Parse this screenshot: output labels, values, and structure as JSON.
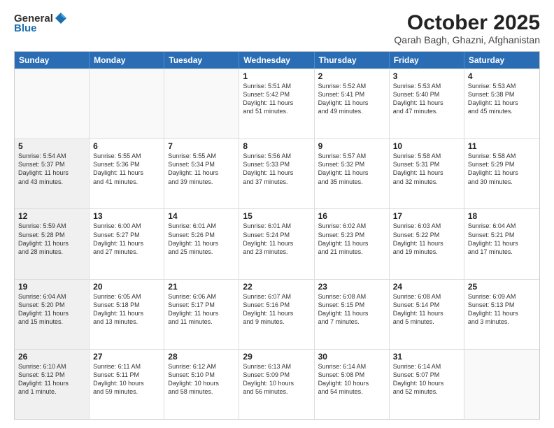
{
  "header": {
    "logo_general": "General",
    "logo_blue": "Blue",
    "month": "October 2025",
    "location": "Qarah Bagh, Ghazni, Afghanistan"
  },
  "weekdays": [
    "Sunday",
    "Monday",
    "Tuesday",
    "Wednesday",
    "Thursday",
    "Friday",
    "Saturday"
  ],
  "weeks": [
    [
      {
        "day": "",
        "text": "",
        "shaded": true
      },
      {
        "day": "",
        "text": "",
        "shaded": true
      },
      {
        "day": "",
        "text": "",
        "shaded": true
      },
      {
        "day": "1",
        "text": "Sunrise: 5:51 AM\nSunset: 5:42 PM\nDaylight: 11 hours\nand 51 minutes.",
        "shaded": false
      },
      {
        "day": "2",
        "text": "Sunrise: 5:52 AM\nSunset: 5:41 PM\nDaylight: 11 hours\nand 49 minutes.",
        "shaded": false
      },
      {
        "day": "3",
        "text": "Sunrise: 5:53 AM\nSunset: 5:40 PM\nDaylight: 11 hours\nand 47 minutes.",
        "shaded": false
      },
      {
        "day": "4",
        "text": "Sunrise: 5:53 AM\nSunset: 5:38 PM\nDaylight: 11 hours\nand 45 minutes.",
        "shaded": false
      }
    ],
    [
      {
        "day": "5",
        "text": "Sunrise: 5:54 AM\nSunset: 5:37 PM\nDaylight: 11 hours\nand 43 minutes.",
        "shaded": true
      },
      {
        "day": "6",
        "text": "Sunrise: 5:55 AM\nSunset: 5:36 PM\nDaylight: 11 hours\nand 41 minutes.",
        "shaded": false
      },
      {
        "day": "7",
        "text": "Sunrise: 5:55 AM\nSunset: 5:34 PM\nDaylight: 11 hours\nand 39 minutes.",
        "shaded": false
      },
      {
        "day": "8",
        "text": "Sunrise: 5:56 AM\nSunset: 5:33 PM\nDaylight: 11 hours\nand 37 minutes.",
        "shaded": false
      },
      {
        "day": "9",
        "text": "Sunrise: 5:57 AM\nSunset: 5:32 PM\nDaylight: 11 hours\nand 35 minutes.",
        "shaded": false
      },
      {
        "day": "10",
        "text": "Sunrise: 5:58 AM\nSunset: 5:31 PM\nDaylight: 11 hours\nand 32 minutes.",
        "shaded": false
      },
      {
        "day": "11",
        "text": "Sunrise: 5:58 AM\nSunset: 5:29 PM\nDaylight: 11 hours\nand 30 minutes.",
        "shaded": false
      }
    ],
    [
      {
        "day": "12",
        "text": "Sunrise: 5:59 AM\nSunset: 5:28 PM\nDaylight: 11 hours\nand 28 minutes.",
        "shaded": true
      },
      {
        "day": "13",
        "text": "Sunrise: 6:00 AM\nSunset: 5:27 PM\nDaylight: 11 hours\nand 27 minutes.",
        "shaded": false
      },
      {
        "day": "14",
        "text": "Sunrise: 6:01 AM\nSunset: 5:26 PM\nDaylight: 11 hours\nand 25 minutes.",
        "shaded": false
      },
      {
        "day": "15",
        "text": "Sunrise: 6:01 AM\nSunset: 5:24 PM\nDaylight: 11 hours\nand 23 minutes.",
        "shaded": false
      },
      {
        "day": "16",
        "text": "Sunrise: 6:02 AM\nSunset: 5:23 PM\nDaylight: 11 hours\nand 21 minutes.",
        "shaded": false
      },
      {
        "day": "17",
        "text": "Sunrise: 6:03 AM\nSunset: 5:22 PM\nDaylight: 11 hours\nand 19 minutes.",
        "shaded": false
      },
      {
        "day": "18",
        "text": "Sunrise: 6:04 AM\nSunset: 5:21 PM\nDaylight: 11 hours\nand 17 minutes.",
        "shaded": false
      }
    ],
    [
      {
        "day": "19",
        "text": "Sunrise: 6:04 AM\nSunset: 5:20 PM\nDaylight: 11 hours\nand 15 minutes.",
        "shaded": true
      },
      {
        "day": "20",
        "text": "Sunrise: 6:05 AM\nSunset: 5:18 PM\nDaylight: 11 hours\nand 13 minutes.",
        "shaded": false
      },
      {
        "day": "21",
        "text": "Sunrise: 6:06 AM\nSunset: 5:17 PM\nDaylight: 11 hours\nand 11 minutes.",
        "shaded": false
      },
      {
        "day": "22",
        "text": "Sunrise: 6:07 AM\nSunset: 5:16 PM\nDaylight: 11 hours\nand 9 minutes.",
        "shaded": false
      },
      {
        "day": "23",
        "text": "Sunrise: 6:08 AM\nSunset: 5:15 PM\nDaylight: 11 hours\nand 7 minutes.",
        "shaded": false
      },
      {
        "day": "24",
        "text": "Sunrise: 6:08 AM\nSunset: 5:14 PM\nDaylight: 11 hours\nand 5 minutes.",
        "shaded": false
      },
      {
        "day": "25",
        "text": "Sunrise: 6:09 AM\nSunset: 5:13 PM\nDaylight: 11 hours\nand 3 minutes.",
        "shaded": false
      }
    ],
    [
      {
        "day": "26",
        "text": "Sunrise: 6:10 AM\nSunset: 5:12 PM\nDaylight: 11 hours\nand 1 minute.",
        "shaded": true
      },
      {
        "day": "27",
        "text": "Sunrise: 6:11 AM\nSunset: 5:11 PM\nDaylight: 10 hours\nand 59 minutes.",
        "shaded": false
      },
      {
        "day": "28",
        "text": "Sunrise: 6:12 AM\nSunset: 5:10 PM\nDaylight: 10 hours\nand 58 minutes.",
        "shaded": false
      },
      {
        "day": "29",
        "text": "Sunrise: 6:13 AM\nSunset: 5:09 PM\nDaylight: 10 hours\nand 56 minutes.",
        "shaded": false
      },
      {
        "day": "30",
        "text": "Sunrise: 6:14 AM\nSunset: 5:08 PM\nDaylight: 10 hours\nand 54 minutes.",
        "shaded": false
      },
      {
        "day": "31",
        "text": "Sunrise: 6:14 AM\nSunset: 5:07 PM\nDaylight: 10 hours\nand 52 minutes.",
        "shaded": false
      },
      {
        "day": "",
        "text": "",
        "shaded": true
      }
    ]
  ]
}
